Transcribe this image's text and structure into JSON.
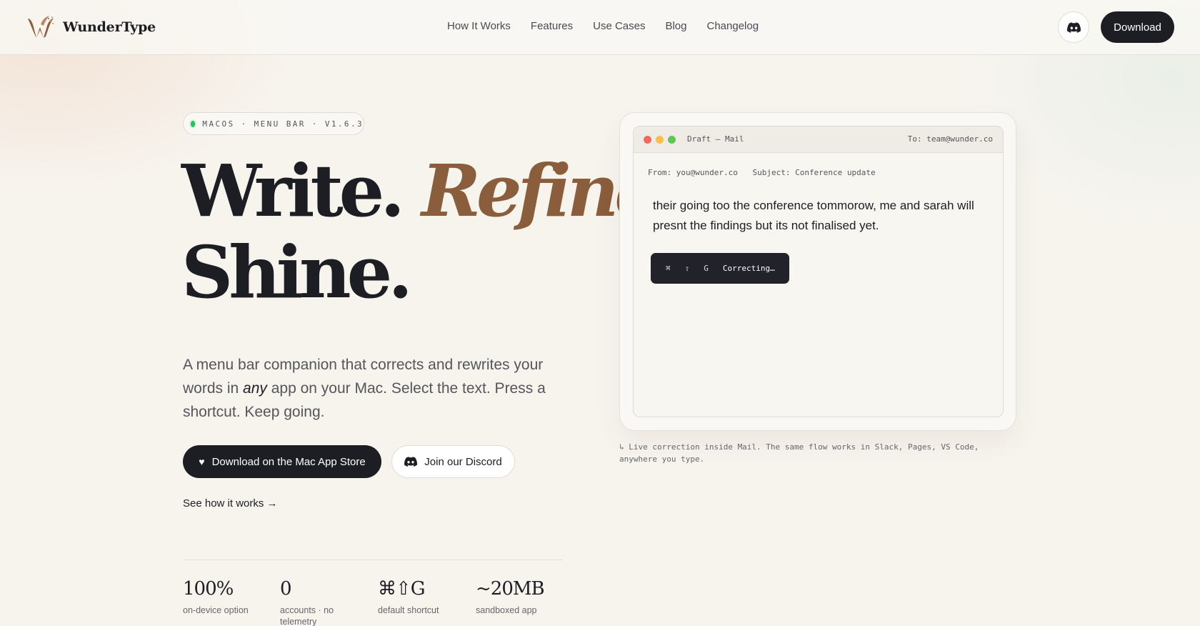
{
  "brand": {
    "name": "WunderType",
    "logo_icon": "butterfly-w-logo"
  },
  "nav": {
    "links": [
      "How It Works",
      "Features",
      "Use Cases",
      "Blog",
      "Changelog"
    ],
    "discord_icon": "discord-icon",
    "download_label": "Download"
  },
  "hero": {
    "badge": "MACOS · MENU BAR · V1.6.3",
    "headline": {
      "word1": "Write.",
      "word2": "Refine.",
      "word3": "Shine."
    },
    "lead": {
      "before": "A menu bar companion that corrects and rewrites your words in ",
      "emphasis": "any",
      "after": " app on your Mac. Select the text. Press a shortcut. Keep going."
    },
    "cta_primary": "Download on the Mac App Store",
    "cta_primary_icon": "heart-icon",
    "cta_secondary": "Join our Discord",
    "cta_secondary_icon": "discord-icon",
    "see_how": "See how it works →",
    "stats": [
      {
        "value": "100%",
        "label": "on-device option"
      },
      {
        "value": "0",
        "label": "accounts · no telemetry"
      },
      {
        "value": "⌘⇧G",
        "label": "default shortcut"
      },
      {
        "value": "~20MB",
        "label": "sandboxed app"
      }
    ]
  },
  "mockup": {
    "title": "Draft — Mail",
    "to": "To: team@wunder.co",
    "from": "From: you@wunder.co",
    "subject": "Subject: Conference update",
    "body": "their going too the conference tommorow, me and sarah will presnt the findings but its not finalised yet.",
    "toast": {
      "keys": [
        "⌘",
        "⇧",
        "G"
      ],
      "status": "Correcting…"
    },
    "caption": "↳ Live correction inside Mail. The same flow works in Slack, Pages, VS Code, anywhere you type."
  },
  "colors": {
    "background": "#f7f4ee",
    "ink": "#1d1d24",
    "accent_brown": "#8a5d3c",
    "status_green": "#2bbf59"
  }
}
